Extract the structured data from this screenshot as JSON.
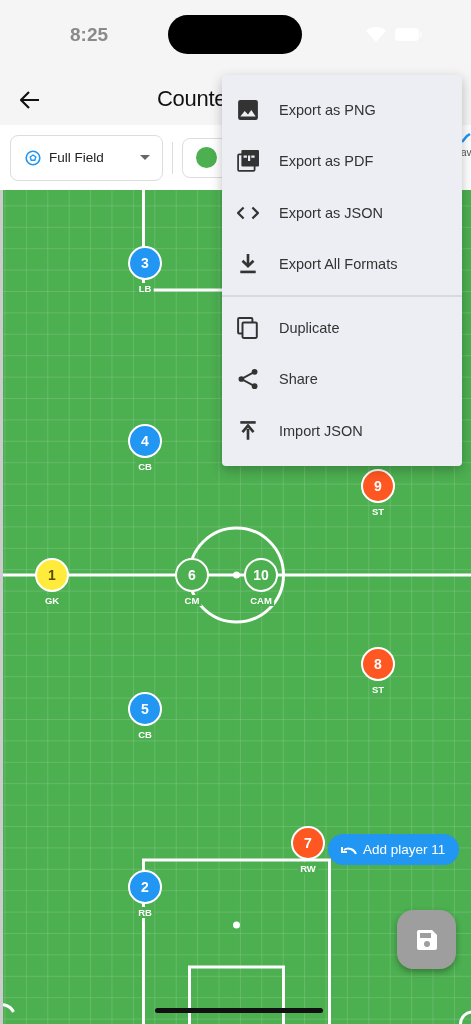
{
  "status_bar": {
    "time": "8:25"
  },
  "app_bar": {
    "title": "Counte"
  },
  "toolbar": {
    "field_type": {
      "value": "Full Field"
    },
    "color_chip": {
      "color": "#4caf50"
    },
    "tool": {
      "label": "av"
    }
  },
  "menu": {
    "groups": [
      [
        {
          "label": "Export as PNG"
        },
        {
          "label": "Export as PDF"
        },
        {
          "label": "Export as JSON"
        },
        {
          "label": "Export All Formats"
        }
      ],
      [
        {
          "label": "Duplicate"
        },
        {
          "label": "Share"
        },
        {
          "label": "Import JSON"
        }
      ]
    ]
  },
  "players": [
    {
      "number": "3",
      "position": "LB",
      "color": "#2196f3"
    },
    {
      "number": "4",
      "position": "CB",
      "color": "#2196f3"
    },
    {
      "number": "9",
      "position": "ST",
      "color": "#ff5722"
    },
    {
      "number": "1",
      "position": "GK",
      "color": "#ffeb3b"
    },
    {
      "number": "6",
      "position": "CM",
      "color": "#4caf50"
    },
    {
      "number": "10",
      "position": "CAM",
      "color": "#4caf50"
    },
    {
      "number": "8",
      "position": "ST",
      "color": "#ff5722"
    },
    {
      "number": "5",
      "position": "CB",
      "color": "#2196f3"
    },
    {
      "number": "7",
      "position": "RW",
      "color": "#ff5722"
    },
    {
      "number": "2",
      "position": "RB",
      "color": "#2196f3"
    }
  ],
  "snackbar": {
    "label": "Add player 11"
  }
}
